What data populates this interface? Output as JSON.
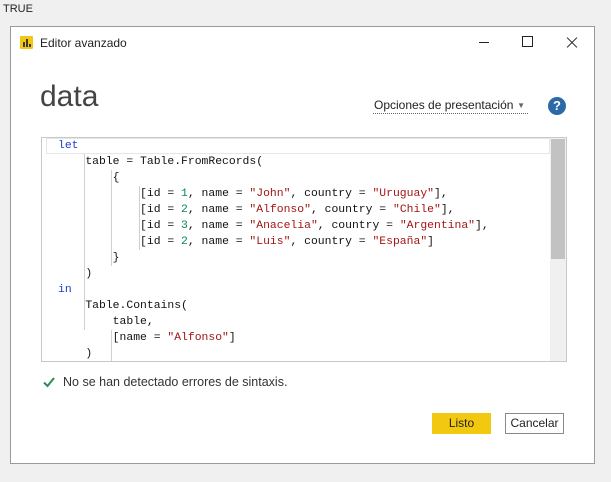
{
  "background": {
    "text": "TRUE"
  },
  "window": {
    "title": "Editor avanzado",
    "controls": {
      "minimize": "minimize-icon",
      "maximize": "maximize-icon",
      "close": "close-icon"
    }
  },
  "query": {
    "name": "data"
  },
  "toolbar": {
    "display_options_label": "Opciones de presentación",
    "help_icon": "question-icon"
  },
  "editor": {
    "lines": [
      "let",
      "    table = Table.FromRecords(",
      "        {",
      "            [id = 1, name = \"John\", country = \"Uruguay\"],",
      "            [id = 2, name = \"Alfonso\", country = \"Chile\"],",
      "            [id = 3, name = \"Anacelia\", country = \"Argentina\"],",
      "            [id = 2, name = \"Luis\", country = \"España\"]",
      "        }",
      "    )",
      "in",
      "    Table.Contains(",
      "        table,",
      "        [name = \"Alfonso\"]",
      "    )"
    ]
  },
  "status": {
    "text": "No se han detectado errores de sintaxis."
  },
  "buttons": {
    "done": "Listo",
    "cancel": "Cancelar"
  },
  "colors": {
    "accent": "#f2c811",
    "keyword": "#1e3bd0",
    "string": "#a31515",
    "number": "#098658"
  }
}
